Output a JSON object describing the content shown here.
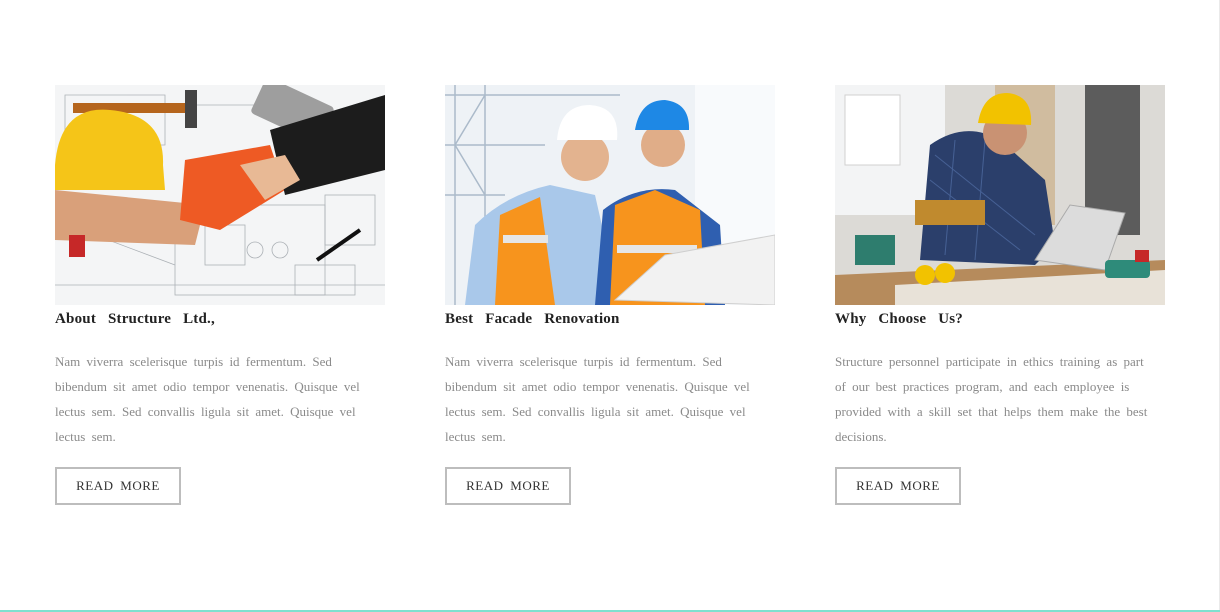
{
  "cards": [
    {
      "title": "About   Structure    Ltd.,",
      "text": "Nam viverra scelerisque  turpis  id fermentum.  Sed bibendum  sit amet  odio tempor  venenatis.  Quisque vel lectus  sem. Sed convallis  ligula sit amet. Quisque  vel lectus  sem.",
      "button": "READ  MORE",
      "image_icon": "handshake-blueprint-photo"
    },
    {
      "title": "Best   Facade   Renovation",
      "text": "Nam viverra scelerisque  turpis  id fermentum.  Sed bibendum  sit amet  odio tempor  venenatis.  Quisque vel lectus  sem. Sed convallis  ligula sit amet. Quisque  vel lectus  sem.",
      "button": "READ  MORE",
      "image_icon": "engineers-laptop-photo"
    },
    {
      "title": "Why  Choose   Us?",
      "text": "Structure  personnel  participate  in ethics  training as part  of our  best  practices  program,  and each employee  is provided  with  a skill set  that  helps them  make  the  best  decisions.",
      "button": "READ  MORE",
      "image_icon": "worker-desk-photo"
    }
  ],
  "colors": {
    "accent_line": "#7fe0cf",
    "title": "#222222",
    "body_text": "#8a8a8a",
    "button_border": "#bdbdbd"
  }
}
